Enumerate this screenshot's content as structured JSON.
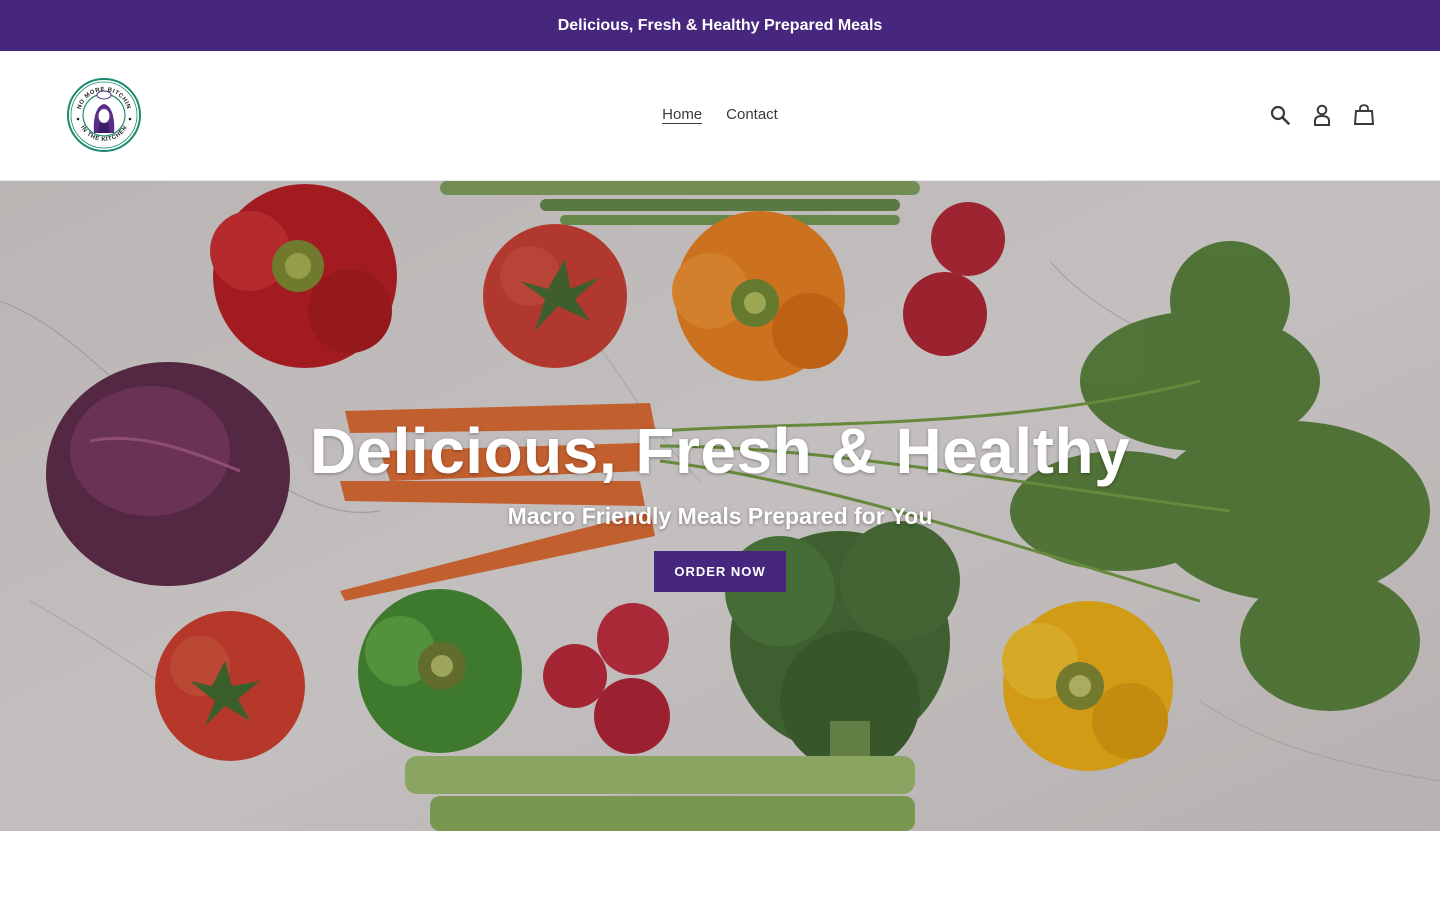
{
  "announcement": {
    "text": "Delicious, Fresh & Healthy Prepared Meals"
  },
  "header": {
    "logo": {
      "top_text": "NO MORE BITCHIN",
      "bottom_text": "IN THE KITCHEN"
    },
    "nav": [
      {
        "label": "Home",
        "active": true
      },
      {
        "label": "Contact",
        "active": false
      }
    ],
    "icons": [
      "search-icon",
      "account-icon",
      "cart-icon"
    ]
  },
  "hero": {
    "title": "Delicious, Fresh & Healthy",
    "subtitle": "Macro Friendly Meals Prepared for You",
    "cta_label": "ORDER NOW"
  },
  "colors": {
    "brand": "#47267d",
    "text": "#3a3a3a",
    "logo_ring": "#1a8a6e"
  }
}
